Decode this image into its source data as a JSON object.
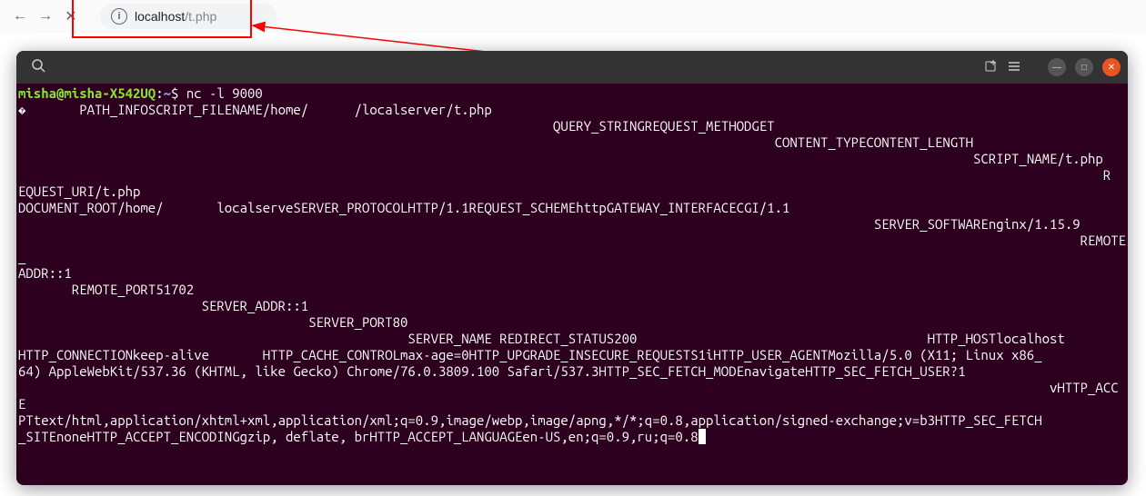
{
  "browser": {
    "url_host": "localhost",
    "url_path": "/t.php"
  },
  "terminal": {
    "prompt_user": "misha@misha-X542UQ",
    "prompt_sep": ":",
    "prompt_path": "~",
    "prompt_dollar": "$",
    "command": "nc -l 9000",
    "output": "�       PATH_INFOSCRIPT_FILENAME/home/      /localserver/t.php\n                                                                      QUERY_STRINGREQUEST_METHODGET\n                                                                                                   CONTENT_TYPECONTENT_LENGTH\n                                                                                                                             SCRIPT_NAME/t.php\n                                                                                                                                              R\nEQUEST_URI/t.php\nDOCUMENT_ROOT/home/       localserveSERVER_PROTOCOLHTTP/1.1REQUEST_SCHEMEhttpGATEWAY_INTERFACECGI/1.1\n                                                                                                                SERVER_SOFTWAREnginx/1.15.9\n                                                                                                                                           REMOTE_\nADDR::1\n       REMOTE_PORT51702\n                        SERVER_ADDR::1\n                                      SERVER_PORT80\n                                                   SERVER_NAME REDIRECT_STATUS200                                      HTTP_HOSTlocalhost\nHTTP_CONNECTIONkeep-alive       HTTP_CACHE_CONTROLmax-age=0HTTP_UPGRADE_INSECURE_REQUESTS1iHTTP_USER_AGENTMozilla/5.0 (X11; Linux x86_\n64) AppleWebKit/537.36 (KHTML, like Gecko) Chrome/76.0.3809.100 Safari/537.3HTTP_SEC_FETCH_MODEnavigateHTTP_SEC_FETCH_USER?1\n                                                                                                                                       vHTTP_ACCE\nPTtext/html,application/xhtml+xml,application/xml;q=0.9,image/webp,image/apng,*/*;q=0.8,application/signed-exchange;v=b3HTTP_SEC_FETCH\n_SITEnoneHTTP_ACCEPT_ENCODINGgzip, deflate, brHTTP_ACCEPT_LANGUAGEen-US,en;q=0.9,ru;q=0.8",
    "cursor": " "
  }
}
